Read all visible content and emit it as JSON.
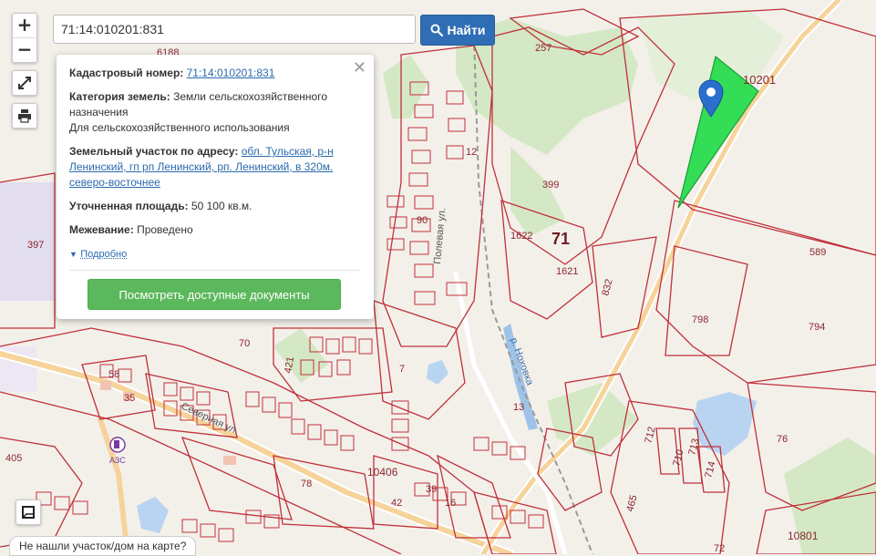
{
  "search": {
    "value": "71:14:010201:831",
    "button_label": "Найти"
  },
  "zoom": {
    "in_label": "+",
    "out_label": "−"
  },
  "popup": {
    "cadastral_label": "Кадастровый номер:",
    "cadastral_value": "71:14:010201:831",
    "category_label": "Категория земель:",
    "category_value": "Земли сельскохозяйственного назначения",
    "usage_value": "Для сельскохозяйственного использования",
    "address_label": "Земельный участок по адресу:",
    "address_value": "обл. Тульская, р-н Ленинский, гп рп Ленинский, рп. Ленинский, в 320м. северо-восточнее",
    "area_label": "Уточненная площадь:",
    "area_value": "50 100 кв.м.",
    "survey_label": "Межевание:",
    "survey_value": "Проведено",
    "more_label": "Подробно",
    "docs_button": "Посмотреть доступные документы",
    "close_symbol": "✕"
  },
  "bottom": {
    "not_found": "Не нашли участок/дом на карте?"
  },
  "map_labels": {
    "n6188": "6188",
    "n257": "257",
    "n10201": "10201",
    "n12": "12",
    "n399": "399",
    "n397": "397",
    "n1622": "1622",
    "n71": "71",
    "n1621": "1621",
    "n589": "589",
    "n832": "832",
    "n798": "798",
    "n794": "794",
    "n90": "90",
    "n70": "70",
    "n7": "7",
    "n58": "58",
    "n35": "35",
    "n421": "421",
    "n405": "405",
    "n10406": "10406",
    "n42": "42",
    "n39": "39",
    "n16": "16",
    "n13": "13",
    "n712": "712",
    "n713": "713",
    "n710": "710",
    "n714": "714",
    "n76": "76",
    "n465": "465",
    "n10801": "10801",
    "n78": "78",
    "n72": "72",
    "street_polevaya": "Полевая ул.",
    "street_severnaya": "Северная ул.",
    "river": "р. Ноховка",
    "azs": "АЗС"
  },
  "colors": {
    "parcel_line": "#c0303a",
    "selected_parcel": "#33dd55",
    "marker": "#2b6fce",
    "accent": "#2f6db5",
    "docs_button": "#5cb85c"
  }
}
